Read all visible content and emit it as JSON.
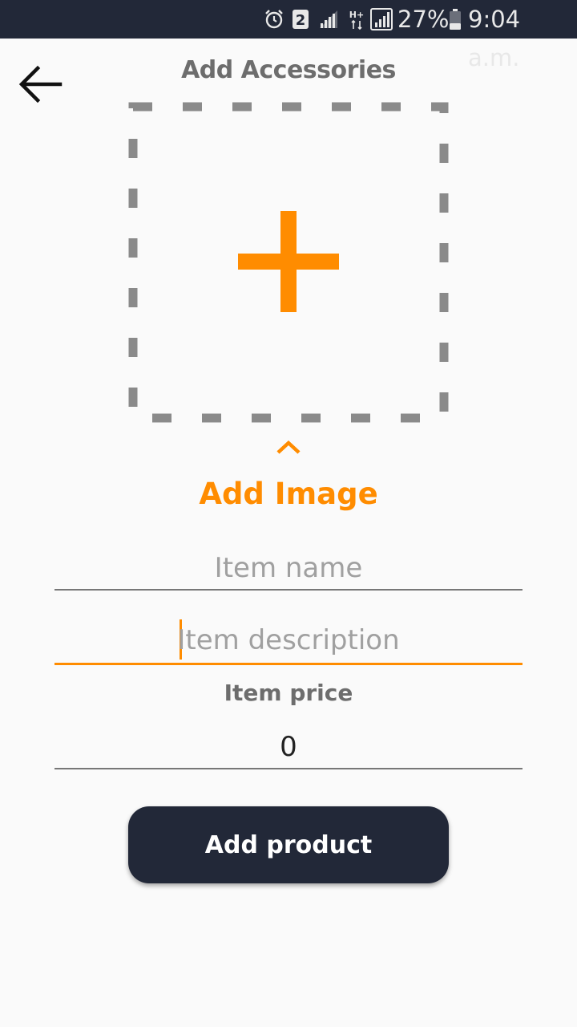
{
  "colors": {
    "accent": "#ff8c00",
    "dark": "#222838",
    "background": "#fafafa",
    "muted_text": "#6d6d6d"
  },
  "status_bar": {
    "icons": [
      "alarm-icon",
      "sim2-icon",
      "signal-icon",
      "hplus-data-icon",
      "signal-icon",
      "battery-icon"
    ],
    "sim_number": "2",
    "data_label": "H+",
    "battery": "27%",
    "time": "9:04 a.m."
  },
  "header": {
    "title": "Add Accessories",
    "back_icon": "arrow-left-icon"
  },
  "image_picker": {
    "icon": "plus-icon",
    "chevron_icon": "chevron-up-icon",
    "label": "Add Image"
  },
  "form": {
    "item_name": {
      "placeholder": "Item name",
      "value": ""
    },
    "item_description": {
      "placeholder": "Item description",
      "value": ""
    },
    "item_price": {
      "label": "Item price",
      "value": "0"
    }
  },
  "submit": {
    "label": "Add product"
  }
}
